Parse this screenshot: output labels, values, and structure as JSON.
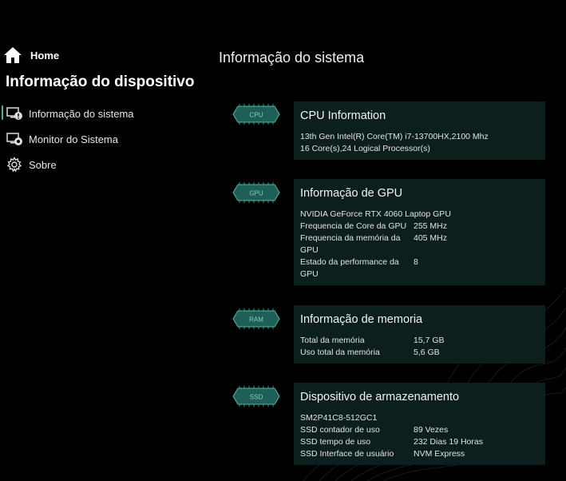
{
  "sidebar": {
    "home_label": "Home",
    "section_title": "Informação do dispositivo",
    "items": [
      {
        "label": "Informação do sistema",
        "icon": "system-info-icon"
      },
      {
        "label": "Monitor do Sistema",
        "icon": "system-monitor-icon"
      },
      {
        "label": "Sobre",
        "icon": "gear-icon"
      }
    ]
  },
  "main": {
    "title": "Informação do sistema",
    "cpu": {
      "chip_label": "CPU",
      "title": "CPU Information",
      "lines": [
        "13th Gen Intel(R) Core(TM) i7-13700HX,2100 Mhz",
        "16 Core(s),24 Logical Processor(s)"
      ]
    },
    "gpu": {
      "chip_label": "GPU",
      "title": "Informação de GPU",
      "name": "NVIDIA GeForce RTX 4060 Laptop GPU",
      "rows": [
        {
          "label": "Frequencia de Core da GPU",
          "value": "255 MHz"
        },
        {
          "label": "Frequencia da memória da",
          "label_cont": "GPU",
          "value": "405 MHz"
        },
        {
          "label": "Estado da performance da",
          "label_cont": "GPU",
          "value": "8"
        }
      ]
    },
    "memory": {
      "chip_label": "RAM",
      "title": "Informação de memoria",
      "rows": [
        {
          "label": "Total da memória",
          "value": "15,7 GB"
        },
        {
          "label": "Uso total da memória",
          "value": "5,6 GB"
        }
      ]
    },
    "storage": {
      "chip_label": "SSD",
      "title": "Dispositivo de armazenamento",
      "model": "SM2P41C8-512GC1",
      "rows": [
        {
          "label": "SSD contador de uso",
          "value": "89 Vezes"
        },
        {
          "label": "SSD tempo de uso",
          "value": "232 Dias 19 Horas"
        },
        {
          "label": "SSD Interface de usuário",
          "value": "NVM Express"
        }
      ]
    }
  },
  "colors": {
    "background": "#000000",
    "card": "#0c1f1d",
    "accent": "#3fb7a3"
  }
}
